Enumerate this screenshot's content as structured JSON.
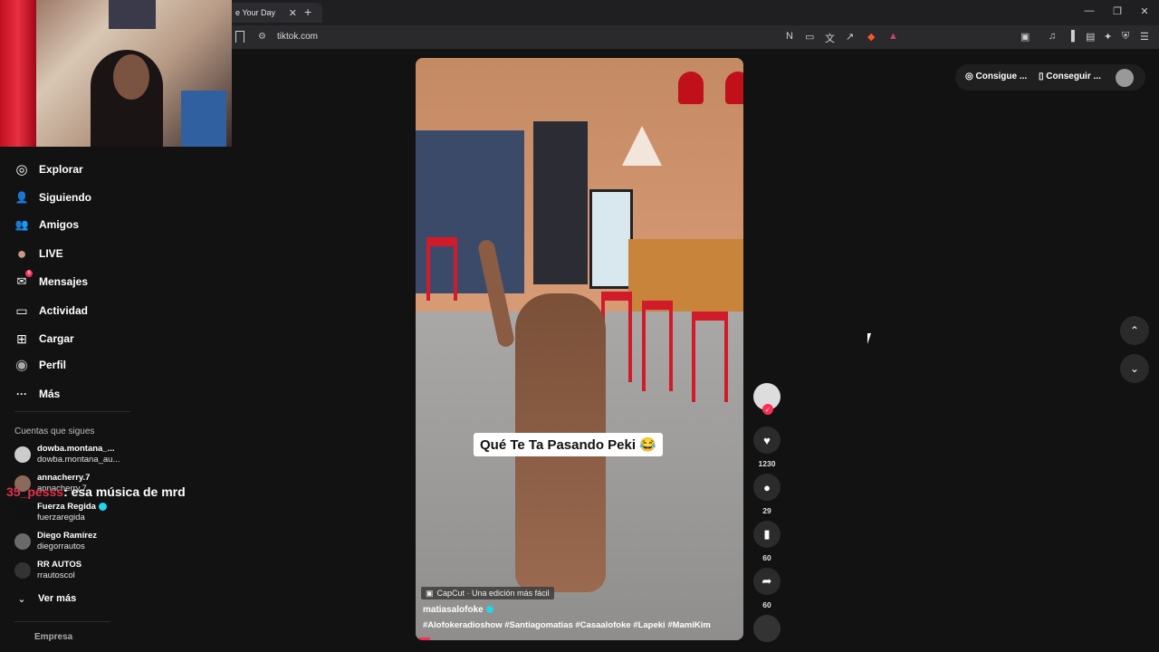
{
  "browser": {
    "tab_title": "e Your Day",
    "tab_close": "✕",
    "new_tab": "+",
    "url": "tiktok.com",
    "window_controls": {
      "minimize": "—",
      "restore": "❐",
      "close": "✕"
    }
  },
  "sidebar": {
    "nav": [
      {
        "label": "Explorar",
        "icon": "compass-icon",
        "glyph": "◎"
      },
      {
        "label": "Siguiendo",
        "icon": "following-icon",
        "glyph": "👤"
      },
      {
        "label": "Amigos",
        "icon": "friends-icon",
        "glyph": "👥"
      },
      {
        "label": "LIVE",
        "icon": "live-icon",
        "glyph": "●"
      },
      {
        "label": "Mensajes",
        "icon": "messages-icon",
        "glyph": "✉",
        "badge": "6"
      },
      {
        "label": "Actividad",
        "icon": "activity-icon",
        "glyph": "▭"
      },
      {
        "label": "Cargar",
        "icon": "upload-icon",
        "glyph": "⊞"
      },
      {
        "label": "Perfil",
        "icon": "profile-icon",
        "glyph": "◉"
      },
      {
        "label": "Más",
        "icon": "more-icon",
        "glyph": "···"
      }
    ],
    "following_title": "Cuentas que sigues",
    "accounts": [
      {
        "name": "dowba.montana_...",
        "handle": "dowba.montana_au..."
      },
      {
        "name": "annacherry.7",
        "handle": "annacherry.7"
      },
      {
        "name": "Fuerza Regida",
        "handle": "fuerzaregida",
        "verified": true
      },
      {
        "name": "Diego Ramírez",
        "handle": "diegorrautos"
      },
      {
        "name": "RR AUTOS",
        "handle": "rrautoscol"
      }
    ],
    "see_more": "Ver más",
    "company": "Empresa"
  },
  "chat_overlay": {
    "user": "35_pesss",
    "message": ": esa música de mrd"
  },
  "video": {
    "caption": "Qué Te Ta Pasando Peki 😂",
    "capcut": "CapCut · Una edición más fácil",
    "author": "matiasalofoke",
    "hashtags": "#Alofokeradioshow  #Santiagomatias  #Casaalofoke  #Lapeki  #MamiKim"
  },
  "actions": {
    "likes": "1230",
    "comments": "29",
    "saves": "60",
    "shares": "60",
    "follow_glyph": "✓"
  },
  "topright": {
    "btn1": "Consigue ...",
    "btn2": "Conseguir ..."
  },
  "arrows": {
    "up": "⌃",
    "down": "⌄"
  }
}
